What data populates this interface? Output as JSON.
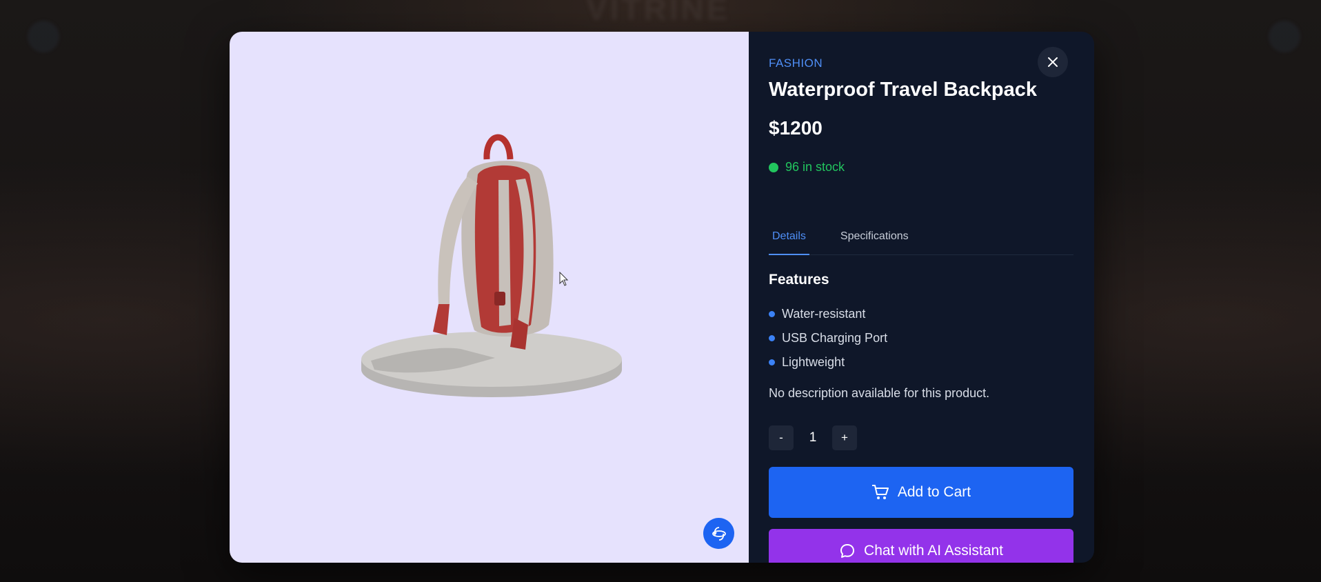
{
  "backdrop": {
    "title": "VITRINE"
  },
  "product": {
    "category": "FASHION",
    "title": "Waterproof Travel Backpack",
    "price": "$1200",
    "stock_text": "96 in stock",
    "tabs": [
      {
        "label": "Details",
        "active": true
      },
      {
        "label": "Specifications",
        "active": false
      }
    ],
    "features_heading": "Features",
    "features": [
      "Water-resistant",
      "USB Charging Port",
      "Lightweight"
    ],
    "description": "No description available for this product.",
    "quantity": {
      "decrement_label": "-",
      "value": "1",
      "increment_label": "+"
    }
  },
  "actions": {
    "add_to_cart": "Add to Cart",
    "chat": "Chat with AI Assistant"
  },
  "icons": {
    "close": "close-icon",
    "cart": "cart-icon",
    "chat": "chat-bubble-icon",
    "rotate": "rotate-3d-icon"
  },
  "colors": {
    "accent_blue": "#1d64f2",
    "category_blue": "#4f8ff7",
    "stock_green": "#22c55e",
    "chat_purple": "#9333ea",
    "panel_bg": "#0f1729",
    "viewer_bg": "#e6e2fd"
  }
}
